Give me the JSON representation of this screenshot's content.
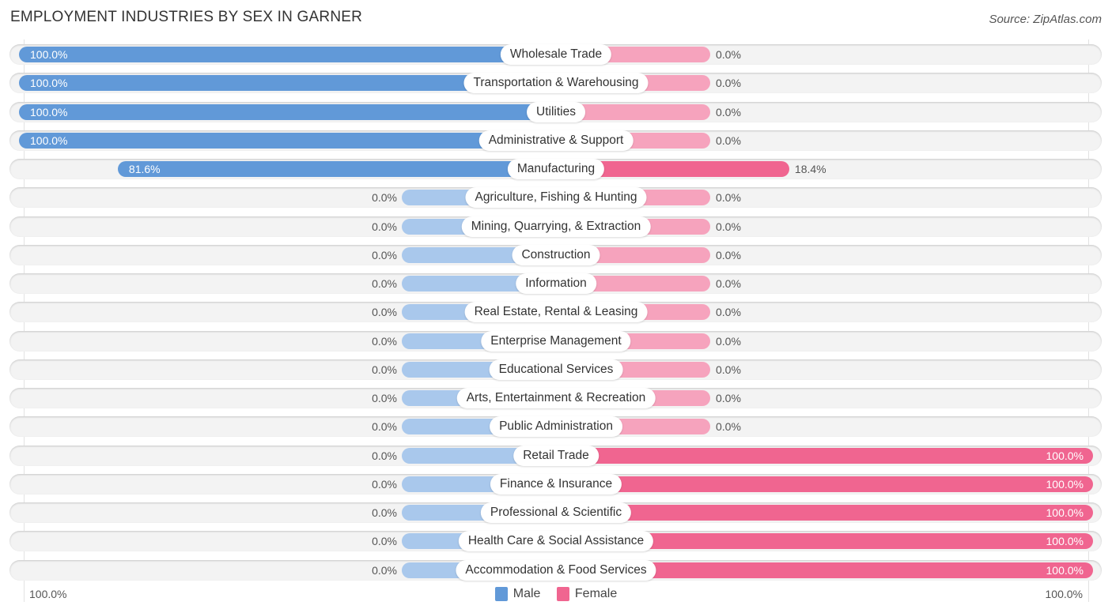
{
  "title": "EMPLOYMENT INDUSTRIES BY SEX IN GARNER",
  "source": "Source: ZipAtlas.com",
  "colors": {
    "male_full": "#6199d8",
    "male_zero": "#a9c8ec",
    "female_full": "#f06590",
    "female_zero": "#f6a3bd"
  },
  "legend": {
    "male": "Male",
    "female": "Female"
  },
  "axis": {
    "left": "100.0%",
    "right": "100.0%"
  },
  "chart_data": {
    "type": "bar",
    "orientation": "horizontal-diverging",
    "title": "EMPLOYMENT INDUSTRIES BY SEX IN GARNER",
    "xlabel": "",
    "ylabel": "",
    "xlim": [
      -100,
      100
    ],
    "legend_position": "bottom",
    "categories": [
      "Wholesale Trade",
      "Transportation & Warehousing",
      "Utilities",
      "Administrative & Support",
      "Manufacturing",
      "Agriculture, Fishing & Hunting",
      "Mining, Quarrying, & Extraction",
      "Construction",
      "Information",
      "Real Estate, Rental & Leasing",
      "Enterprise Management",
      "Educational Services",
      "Arts, Entertainment & Recreation",
      "Public Administration",
      "Retail Trade",
      "Finance & Insurance",
      "Professional & Scientific",
      "Health Care & Social Assistance",
      "Accommodation & Food Services"
    ],
    "series": [
      {
        "name": "Male",
        "values": [
          100.0,
          100.0,
          100.0,
          100.0,
          81.6,
          0.0,
          0.0,
          0.0,
          0.0,
          0.0,
          0.0,
          0.0,
          0.0,
          0.0,
          0.0,
          0.0,
          0.0,
          0.0,
          0.0
        ],
        "labels": [
          "100.0%",
          "100.0%",
          "100.0%",
          "100.0%",
          "81.6%",
          "0.0%",
          "0.0%",
          "0.0%",
          "0.0%",
          "0.0%",
          "0.0%",
          "0.0%",
          "0.0%",
          "0.0%",
          "0.0%",
          "0.0%",
          "0.0%",
          "0.0%",
          "0.0%"
        ]
      },
      {
        "name": "Female",
        "values": [
          0.0,
          0.0,
          0.0,
          0.0,
          18.4,
          0.0,
          0.0,
          0.0,
          0.0,
          0.0,
          0.0,
          0.0,
          0.0,
          0.0,
          100.0,
          100.0,
          100.0,
          100.0,
          100.0
        ],
        "labels": [
          "0.0%",
          "0.0%",
          "0.0%",
          "0.0%",
          "18.4%",
          "0.0%",
          "0.0%",
          "0.0%",
          "0.0%",
          "0.0%",
          "0.0%",
          "0.0%",
          "0.0%",
          "0.0%",
          "100.0%",
          "100.0%",
          "100.0%",
          "100.0%",
          "100.0%"
        ]
      }
    ]
  }
}
